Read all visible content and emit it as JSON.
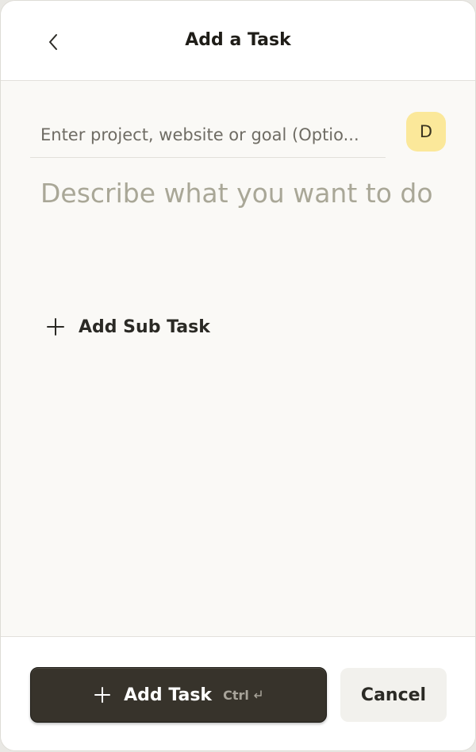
{
  "header": {
    "title": "Add a Task",
    "back_icon": "chevron-left-icon"
  },
  "form": {
    "project_placeholder": "Enter project, website or goal (Optio...",
    "project_value": "",
    "task_placeholder": "Describe what you want to do",
    "task_value": "",
    "avatar_initial": "D",
    "add_subtask_label": "Add Sub Task",
    "add_subtask_icon": "plus-icon"
  },
  "footer": {
    "add_task_label": "Add Task",
    "add_task_icon": "plus-icon",
    "shortcut_label": "Ctrl",
    "shortcut_icon": "enter-icon",
    "cancel_label": "Cancel"
  },
  "colors": {
    "primary_button": "#37332b",
    "avatar_bg": "#fbe89a",
    "placeholder": "#a9a797",
    "background": "#faf9f6"
  }
}
